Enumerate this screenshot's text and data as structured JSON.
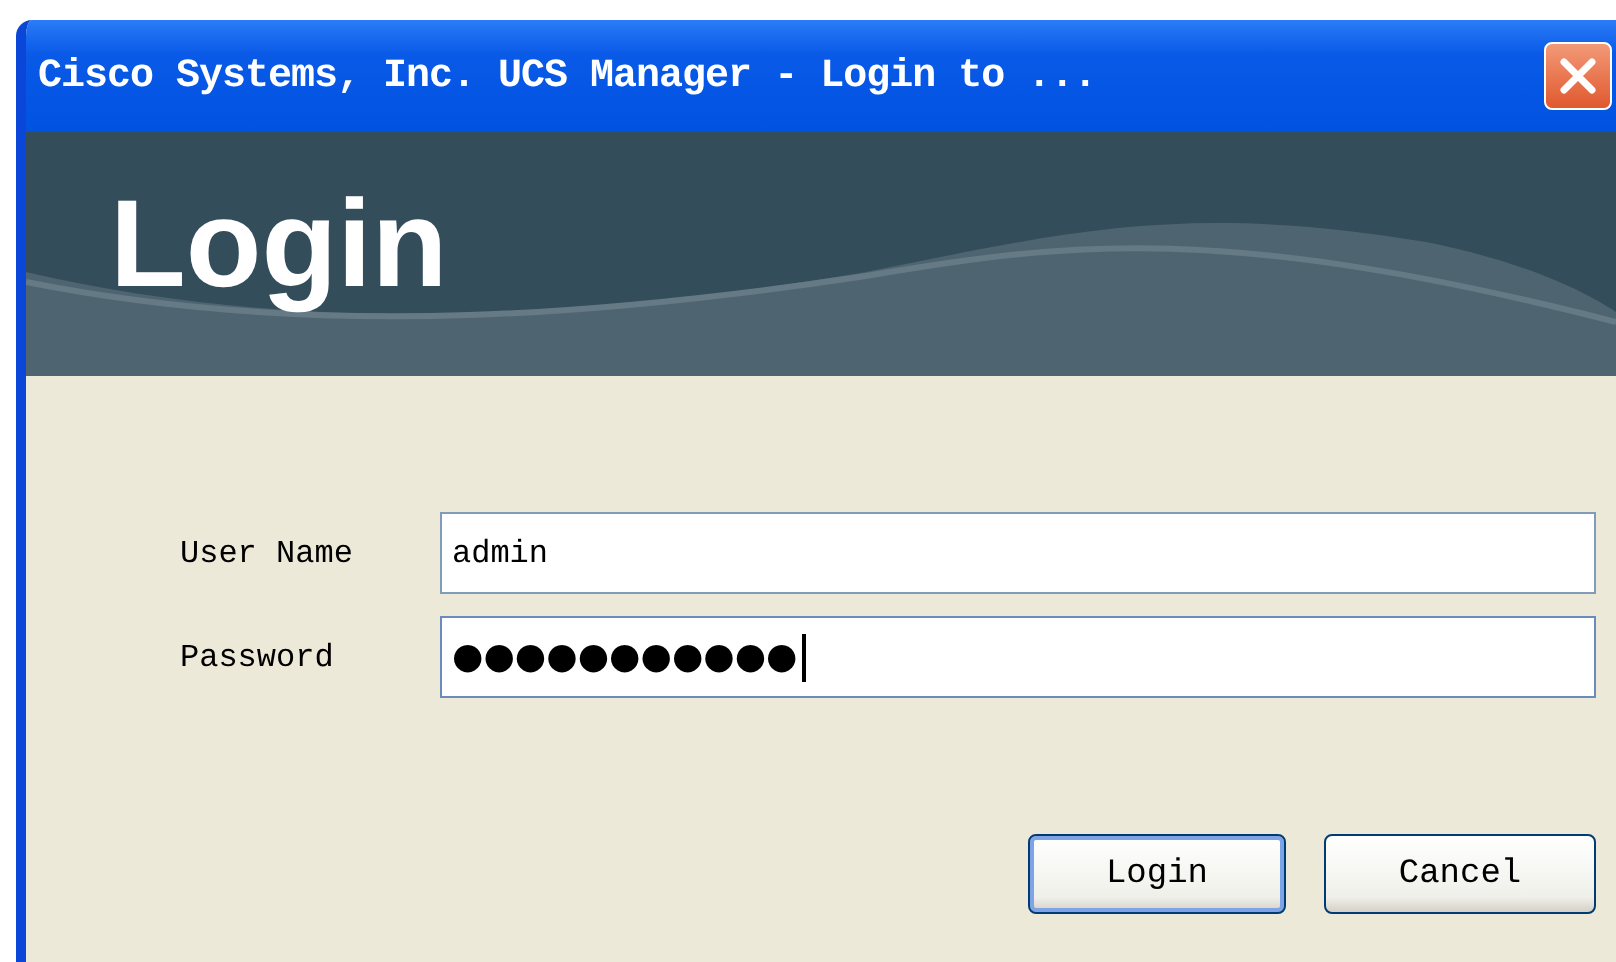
{
  "window": {
    "title": "Cisco Systems, Inc. UCS Manager - Login to ..."
  },
  "banner": {
    "title": "Login"
  },
  "fields": [
    {
      "label": "User Name",
      "value": "admin",
      "focused": false
    },
    {
      "label": "Password",
      "value": "●●●●●●●●●●●",
      "focused": true
    }
  ],
  "buttons": [
    {
      "label": "Login",
      "default": true
    },
    {
      "label": "Cancel",
      "default": false
    }
  ]
}
